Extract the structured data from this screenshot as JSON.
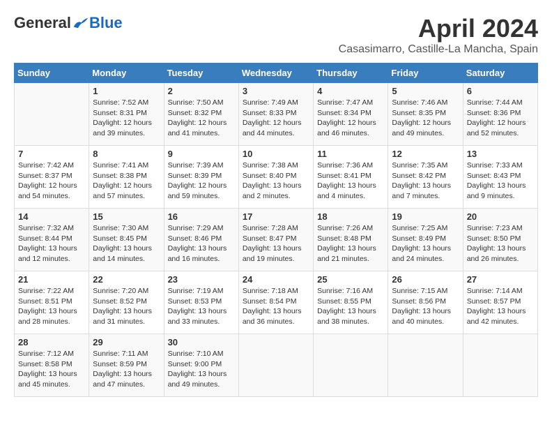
{
  "header": {
    "logo_general": "General",
    "logo_blue": "Blue",
    "month_title": "April 2024",
    "subtitle": "Casasimarro, Castille-La Mancha, Spain"
  },
  "weekdays": [
    "Sunday",
    "Monday",
    "Tuesday",
    "Wednesday",
    "Thursday",
    "Friday",
    "Saturday"
  ],
  "weeks": [
    [
      {
        "day": "",
        "info": ""
      },
      {
        "day": "1",
        "info": "Sunrise: 7:52 AM\nSunset: 8:31 PM\nDaylight: 12 hours\nand 39 minutes."
      },
      {
        "day": "2",
        "info": "Sunrise: 7:50 AM\nSunset: 8:32 PM\nDaylight: 12 hours\nand 41 minutes."
      },
      {
        "day": "3",
        "info": "Sunrise: 7:49 AM\nSunset: 8:33 PM\nDaylight: 12 hours\nand 44 minutes."
      },
      {
        "day": "4",
        "info": "Sunrise: 7:47 AM\nSunset: 8:34 PM\nDaylight: 12 hours\nand 46 minutes."
      },
      {
        "day": "5",
        "info": "Sunrise: 7:46 AM\nSunset: 8:35 PM\nDaylight: 12 hours\nand 49 minutes."
      },
      {
        "day": "6",
        "info": "Sunrise: 7:44 AM\nSunset: 8:36 PM\nDaylight: 12 hours\nand 52 minutes."
      }
    ],
    [
      {
        "day": "7",
        "info": "Sunrise: 7:42 AM\nSunset: 8:37 PM\nDaylight: 12 hours\nand 54 minutes."
      },
      {
        "day": "8",
        "info": "Sunrise: 7:41 AM\nSunset: 8:38 PM\nDaylight: 12 hours\nand 57 minutes."
      },
      {
        "day": "9",
        "info": "Sunrise: 7:39 AM\nSunset: 8:39 PM\nDaylight: 12 hours\nand 59 minutes."
      },
      {
        "day": "10",
        "info": "Sunrise: 7:38 AM\nSunset: 8:40 PM\nDaylight: 13 hours\nand 2 minutes."
      },
      {
        "day": "11",
        "info": "Sunrise: 7:36 AM\nSunset: 8:41 PM\nDaylight: 13 hours\nand 4 minutes."
      },
      {
        "day": "12",
        "info": "Sunrise: 7:35 AM\nSunset: 8:42 PM\nDaylight: 13 hours\nand 7 minutes."
      },
      {
        "day": "13",
        "info": "Sunrise: 7:33 AM\nSunset: 8:43 PM\nDaylight: 13 hours\nand 9 minutes."
      }
    ],
    [
      {
        "day": "14",
        "info": "Sunrise: 7:32 AM\nSunset: 8:44 PM\nDaylight: 13 hours\nand 12 minutes."
      },
      {
        "day": "15",
        "info": "Sunrise: 7:30 AM\nSunset: 8:45 PM\nDaylight: 13 hours\nand 14 minutes."
      },
      {
        "day": "16",
        "info": "Sunrise: 7:29 AM\nSunset: 8:46 PM\nDaylight: 13 hours\nand 16 minutes."
      },
      {
        "day": "17",
        "info": "Sunrise: 7:28 AM\nSunset: 8:47 PM\nDaylight: 13 hours\nand 19 minutes."
      },
      {
        "day": "18",
        "info": "Sunrise: 7:26 AM\nSunset: 8:48 PM\nDaylight: 13 hours\nand 21 minutes."
      },
      {
        "day": "19",
        "info": "Sunrise: 7:25 AM\nSunset: 8:49 PM\nDaylight: 13 hours\nand 24 minutes."
      },
      {
        "day": "20",
        "info": "Sunrise: 7:23 AM\nSunset: 8:50 PM\nDaylight: 13 hours\nand 26 minutes."
      }
    ],
    [
      {
        "day": "21",
        "info": "Sunrise: 7:22 AM\nSunset: 8:51 PM\nDaylight: 13 hours\nand 28 minutes."
      },
      {
        "day": "22",
        "info": "Sunrise: 7:20 AM\nSunset: 8:52 PM\nDaylight: 13 hours\nand 31 minutes."
      },
      {
        "day": "23",
        "info": "Sunrise: 7:19 AM\nSunset: 8:53 PM\nDaylight: 13 hours\nand 33 minutes."
      },
      {
        "day": "24",
        "info": "Sunrise: 7:18 AM\nSunset: 8:54 PM\nDaylight: 13 hours\nand 36 minutes."
      },
      {
        "day": "25",
        "info": "Sunrise: 7:16 AM\nSunset: 8:55 PM\nDaylight: 13 hours\nand 38 minutes."
      },
      {
        "day": "26",
        "info": "Sunrise: 7:15 AM\nSunset: 8:56 PM\nDaylight: 13 hours\nand 40 minutes."
      },
      {
        "day": "27",
        "info": "Sunrise: 7:14 AM\nSunset: 8:57 PM\nDaylight: 13 hours\nand 42 minutes."
      }
    ],
    [
      {
        "day": "28",
        "info": "Sunrise: 7:12 AM\nSunset: 8:58 PM\nDaylight: 13 hours\nand 45 minutes."
      },
      {
        "day": "29",
        "info": "Sunrise: 7:11 AM\nSunset: 8:59 PM\nDaylight: 13 hours\nand 47 minutes."
      },
      {
        "day": "30",
        "info": "Sunrise: 7:10 AM\nSunset: 9:00 PM\nDaylight: 13 hours\nand 49 minutes."
      },
      {
        "day": "",
        "info": ""
      },
      {
        "day": "",
        "info": ""
      },
      {
        "day": "",
        "info": ""
      },
      {
        "day": "",
        "info": ""
      }
    ]
  ]
}
